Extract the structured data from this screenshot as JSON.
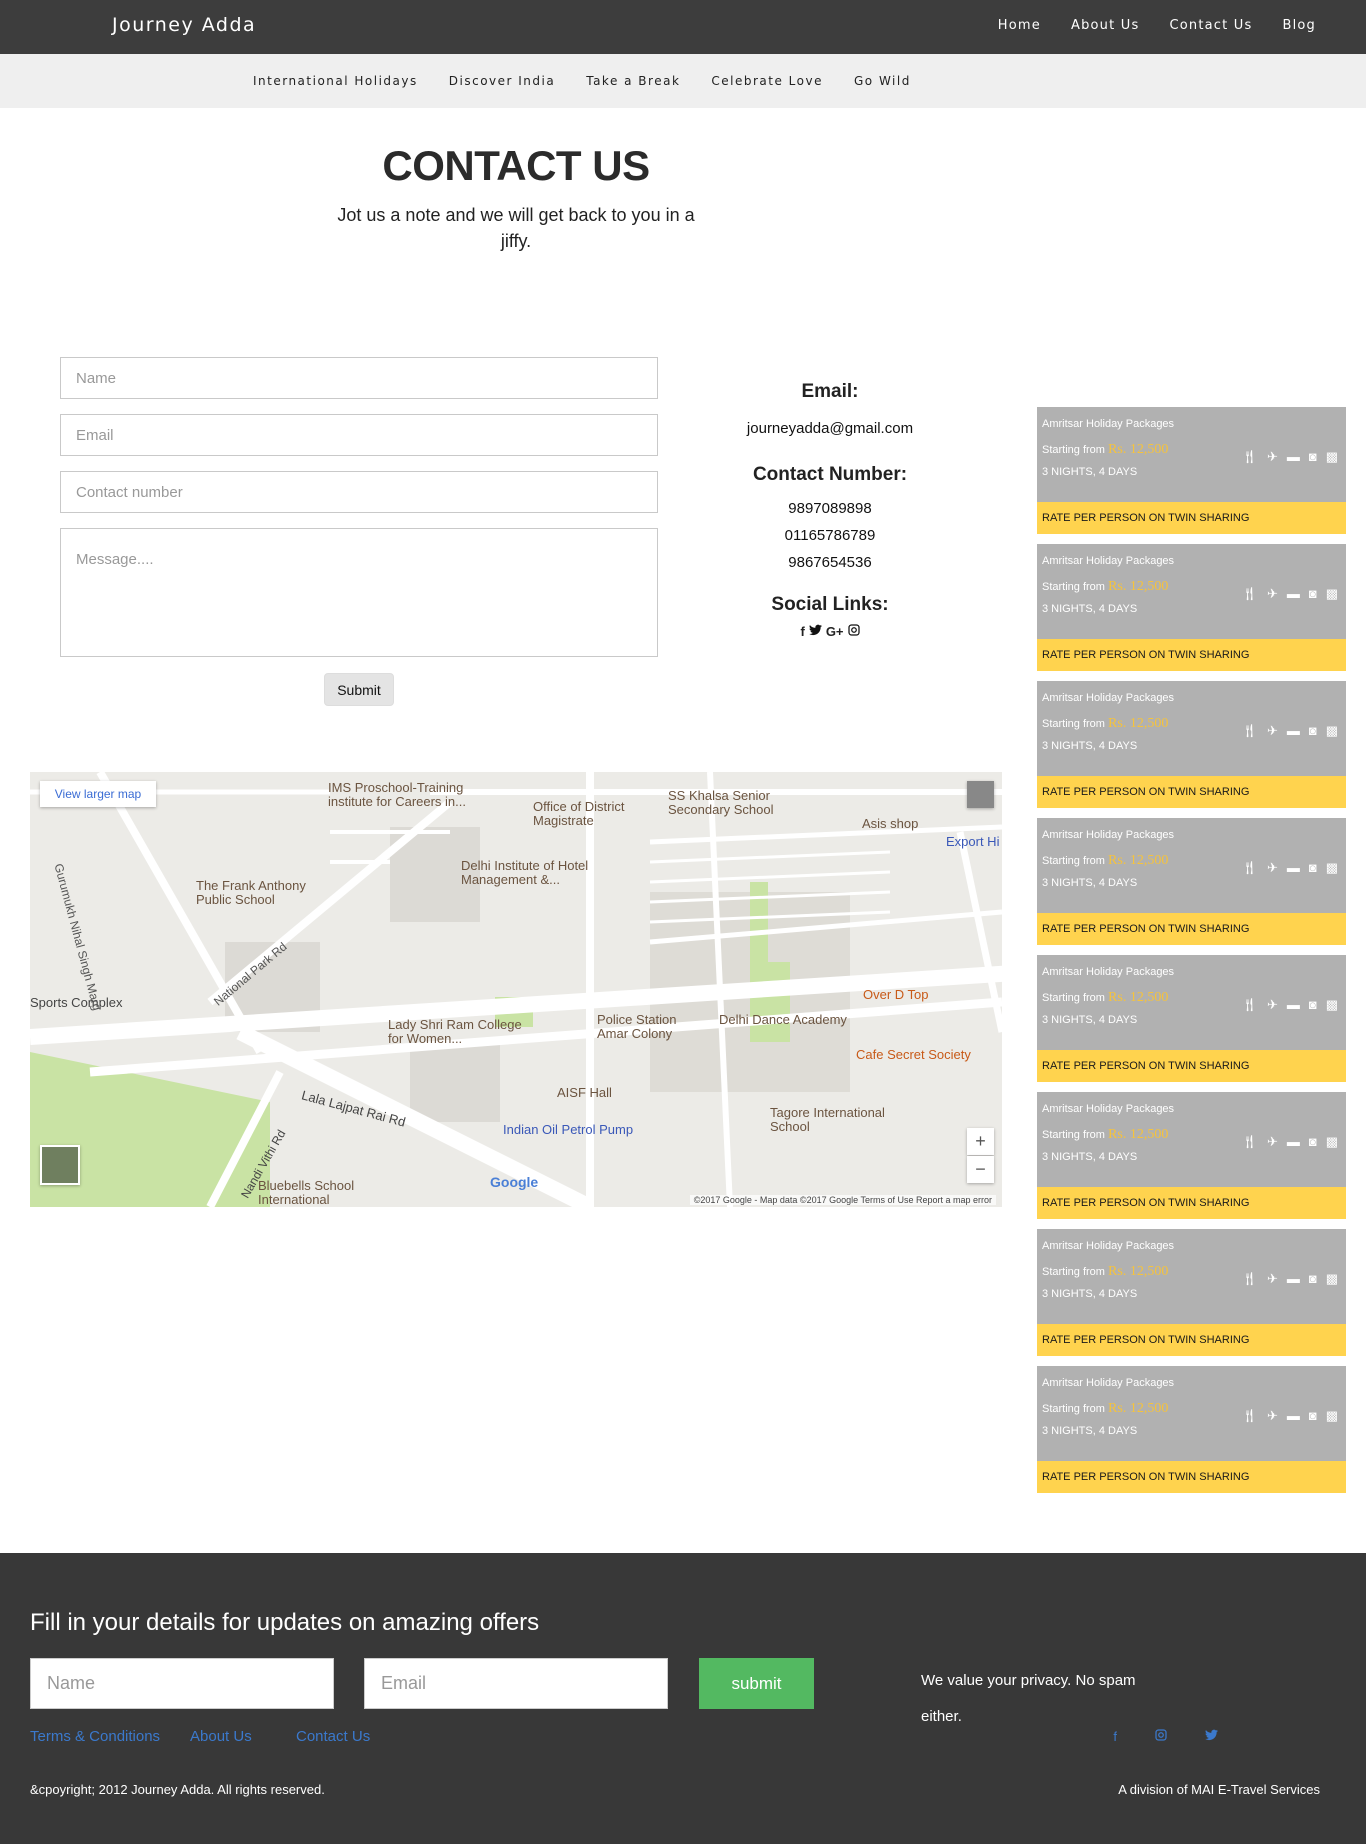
{
  "header": {
    "brand": "Journey Adda",
    "nav": [
      "Home",
      "About Us",
      "Contact Us",
      "Blog"
    ]
  },
  "subnav": [
    "International Holidays",
    "Discover India",
    "Take a Break",
    "Celebrate Love",
    "Go Wild"
  ],
  "hero": {
    "title": "CONTACT US",
    "subtitle": "Jot us a note and we will get back to you in a jiffy."
  },
  "form": {
    "name_placeholder": "Name",
    "email_placeholder": "Email",
    "contact_placeholder": "Contact number",
    "message_placeholder": "Message....",
    "submit_label": "Submit"
  },
  "contact_info": {
    "email_heading": "Email:",
    "email": "journeyadda@gmail.com",
    "phone_heading": "Contact Number:",
    "phones": [
      "9897089898",
      "01165786789",
      "9867654536"
    ],
    "social_heading": "Social Links:"
  },
  "map": {
    "larger_map": "View larger map",
    "zoom_in": "+",
    "zoom_out": "−",
    "attribution": "©2017 Google - Map data ©2017 Google   Terms of Use   Report a map error",
    "google": "Google",
    "labels": [
      "IMS Proschool-Training institute for Careers in...",
      "Office of District Magistrate",
      "SS Khalsa Senior Secondary School",
      "Asis shop",
      "Export Hi",
      "The Frank Anthony Public School",
      "Delhi Institute of Hotel Management &...",
      "Sports Complex",
      "National Park Rd",
      "Lady Shri Ram College for Women...",
      "Police Station Amar Colony",
      "Delhi Dance Academy",
      "Over D Top",
      "Cafe Secret Society",
      "AISF Hall",
      "Lala Lajpat Rai Rd",
      "Tagore International School",
      "Indian Oil Petrol Pump",
      "Nandi Vithi Rd",
      "Bluebells School International",
      "Gurumukh Nihal Singh Marg"
    ]
  },
  "packages": [
    {
      "title": "Amritsar Holiday Packages",
      "starting": "Starting from",
      "price": "Rs. 12,500",
      "duration": "3 NIGHTS, 4 DAYS",
      "rate": "RATE PER PERSON ON TWIN SHARING"
    },
    {
      "title": "Amritsar Holiday Packages",
      "starting": "Starting from",
      "price": "Rs. 12,500",
      "duration": "3 NIGHTS, 4 DAYS",
      "rate": "RATE PER PERSON ON TWIN SHARING"
    },
    {
      "title": "Amritsar Holiday Packages",
      "starting": "Starting from",
      "price": "Rs. 12,500",
      "duration": "3 NIGHTS, 4 DAYS",
      "rate": "RATE PER PERSON ON TWIN SHARING"
    },
    {
      "title": "Amritsar Holiday Packages",
      "starting": "Starting from",
      "price": "Rs. 12,500",
      "duration": "3 NIGHTS, 4 DAYS",
      "rate": "RATE PER PERSON ON TWIN SHARING"
    },
    {
      "title": "Amritsar Holiday Packages",
      "starting": "Starting from",
      "price": "Rs. 12,500",
      "duration": "3 NIGHTS, 4 DAYS",
      "rate": "RATE PER PERSON ON TWIN SHARING"
    },
    {
      "title": "Amritsar Holiday Packages",
      "starting": "Starting from",
      "price": "Rs. 12,500",
      "duration": "3 NIGHTS, 4 DAYS",
      "rate": "RATE PER PERSON ON TWIN SHARING"
    },
    {
      "title": "Amritsar Holiday Packages",
      "starting": "Starting from",
      "price": "Rs. 12,500",
      "duration": "3 NIGHTS, 4 DAYS",
      "rate": "RATE PER PERSON ON TWIN SHARING"
    },
    {
      "title": "Amritsar Holiday Packages",
      "starting": "Starting from",
      "price": "Rs. 12,500",
      "duration": "3 NIGHTS, 4 DAYS",
      "rate": "RATE PER PERSON ON TWIN SHARING"
    }
  ],
  "footer": {
    "heading": "Fill in your details for updates on amazing offers",
    "name_placeholder": "Name",
    "email_placeholder": "Email",
    "submit_label": "submit",
    "privacy": "We value your privacy. No spam either.",
    "links": [
      "Terms & Conditions",
      "About Us",
      "Contact Us"
    ],
    "copyright": "&cpoyright; 2012 Journey Adda. All rights reserved.",
    "division": "A division of MAI E-Travel Services"
  },
  "colors": {
    "header_bg": "#3d3d3d",
    "package_bg": "#b1b1b1",
    "package_rate_bg": "#ffd34e",
    "price": "#f6c33c",
    "footer_bg": "#383838",
    "footer_submit": "#53b961",
    "link": "#3b79cc"
  }
}
